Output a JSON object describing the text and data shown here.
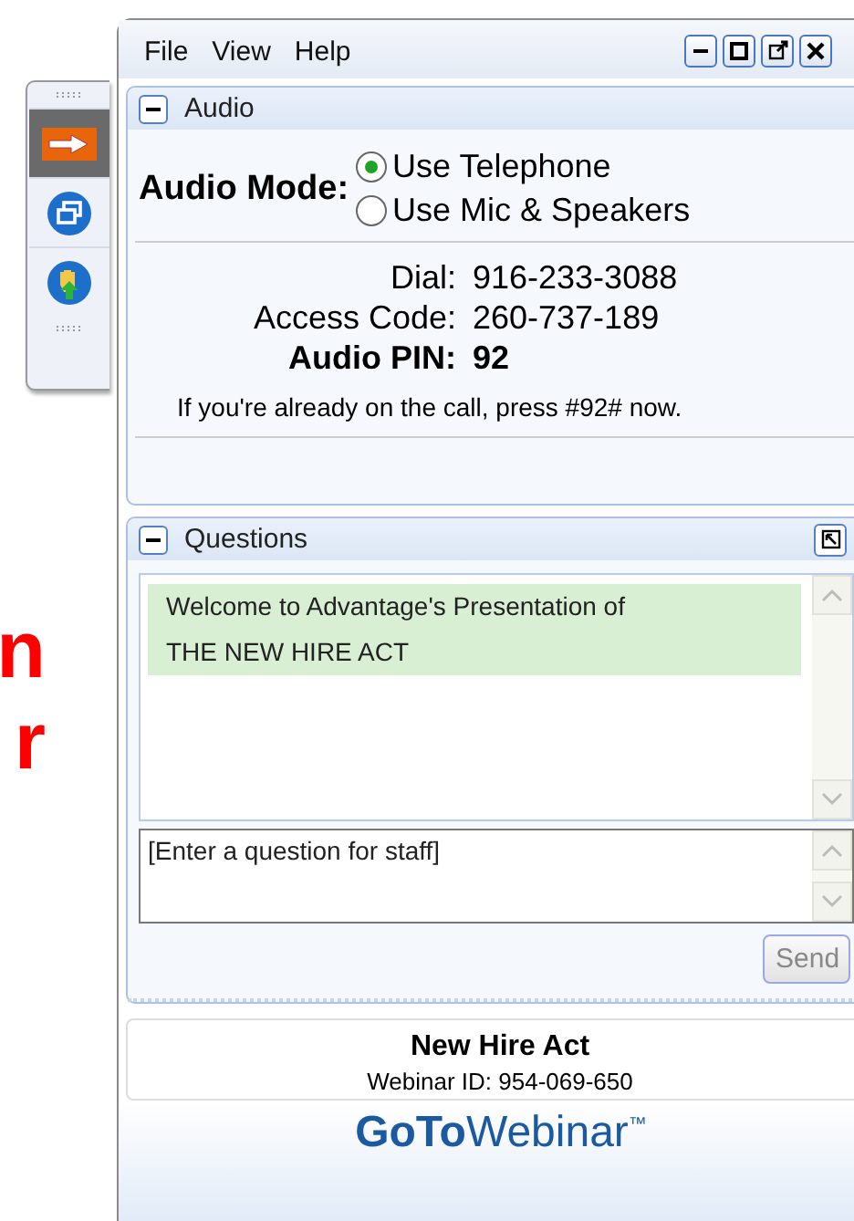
{
  "backdrop_text": [
    "n",
    "r"
  ],
  "toolbar": [
    {
      "kind": "arrow",
      "selected": true
    },
    {
      "kind": "restore",
      "selected": false
    },
    {
      "kind": "raise-hand",
      "selected": false
    }
  ],
  "menu": [
    "File",
    "View",
    "Help"
  ],
  "window_controls": [
    {
      "kind": "minimize"
    },
    {
      "kind": "maximize"
    },
    {
      "kind": "popout"
    },
    {
      "kind": "close"
    }
  ],
  "audio": {
    "title": "Audio",
    "expanded": true,
    "mode_label": "Audio Mode:",
    "options": [
      {
        "label": "Use Telephone",
        "selected": true
      },
      {
        "label": "Use Mic & Speakers",
        "selected": false
      }
    ],
    "details": [
      {
        "label": "Dial:",
        "value": "916-233-3088",
        "bold": false
      },
      {
        "label": "Access Code:",
        "value": "260-737-189",
        "bold": false
      },
      {
        "label": "Audio PIN:",
        "value": "92",
        "bold": true
      }
    ],
    "note": "If you're already on the call, press #92# now."
  },
  "questions": {
    "title": "Questions",
    "expanded": true,
    "messages": [
      "Welcome to Advantage's Presentation of",
      "THE NEW HIRE ACT"
    ],
    "placeholder": "[Enter a question for staff]",
    "send": {
      "label": "Send",
      "disabled": true
    }
  },
  "footer": {
    "title": "New Hire Act",
    "webinar_id": "Webinar ID: 954-069-650"
  },
  "logo": {
    "bold": "GoTo",
    "light": "Webinar",
    "mark": "™"
  }
}
